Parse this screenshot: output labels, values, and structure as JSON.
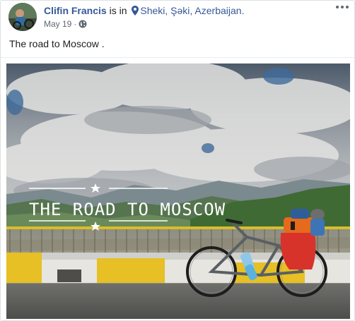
{
  "post": {
    "author": "Clifin Francis",
    "connector": "is in",
    "location": "Sheki, Şəki, Azerbaijan.",
    "date": "May 19",
    "separator": "·",
    "caption": "The road to Moscow .",
    "more_icon": "three-dots-icon",
    "privacy_icon": "globe-icon",
    "location_icon": "map-pin-icon"
  },
  "photo": {
    "overlay_text": "THE ROAD TO MOSCOW"
  },
  "colors": {
    "link_blue": "#365899",
    "text": "#1c1e21",
    "meta_gray": "#616770",
    "barrier_yellow": "#e8c21f",
    "bag_red": "#d8332a",
    "bag_orange": "#e66a1c"
  }
}
